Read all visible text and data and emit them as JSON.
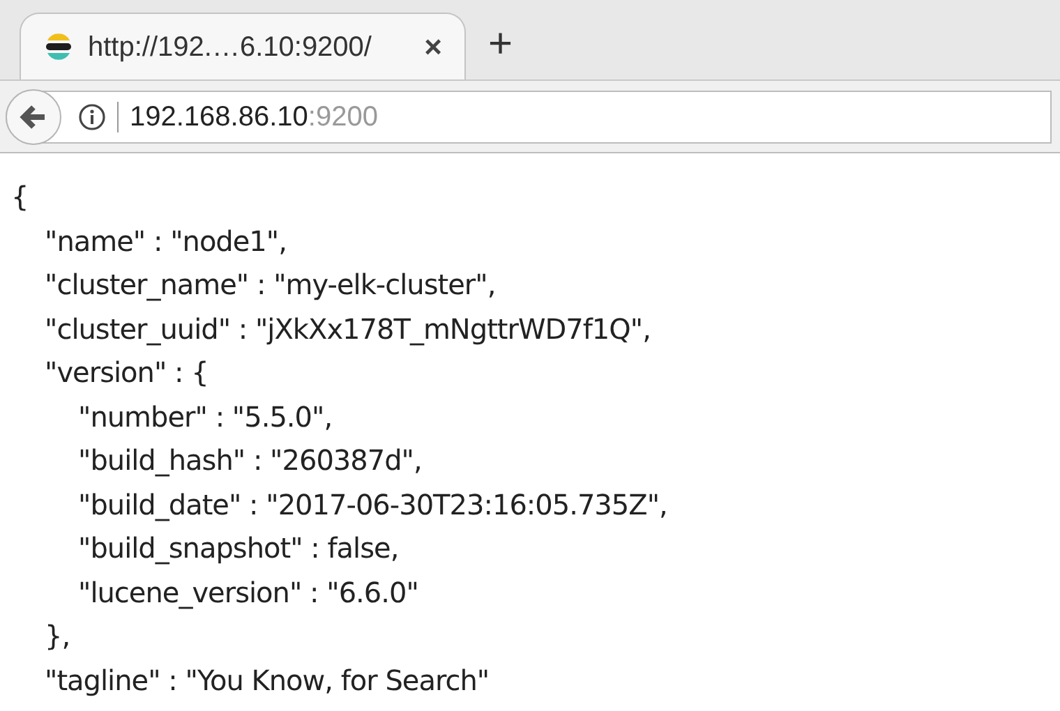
{
  "tab": {
    "title": "http://192.…6.10:9200/",
    "close": "×",
    "selected": true
  },
  "new_tab": "+",
  "address": {
    "host": "192.168.86.10",
    "port": ":9200"
  },
  "document": [
    {
      "text": "{",
      "children": [
        {
          "text": "\"name\" : \"node1\","
        },
        {
          "text": "\"cluster_name\" : \"my-elk-cluster\","
        },
        {
          "text": "\"cluster_uuid\" : \"jXkXx178T_mNgttrWD7f1Q\","
        },
        {
          "text": "\"version\" : {",
          "children": [
            {
              "text": "\"number\" : \"5.5.0\","
            },
            {
              "text": "\"build_hash\" : \"260387d\","
            },
            {
              "text": "\"build_date\" : \"2017-06-30T23:16:05.735Z\","
            },
            {
              "text": "\"build_snapshot\" : false,"
            },
            {
              "text": "\"lucene_version\" : \"6.6.0\""
            }
          ]
        },
        {
          "text": "},"
        },
        {
          "text": "\"tagline\" : \"You Know, for Search\""
        }
      ]
    }
  ]
}
